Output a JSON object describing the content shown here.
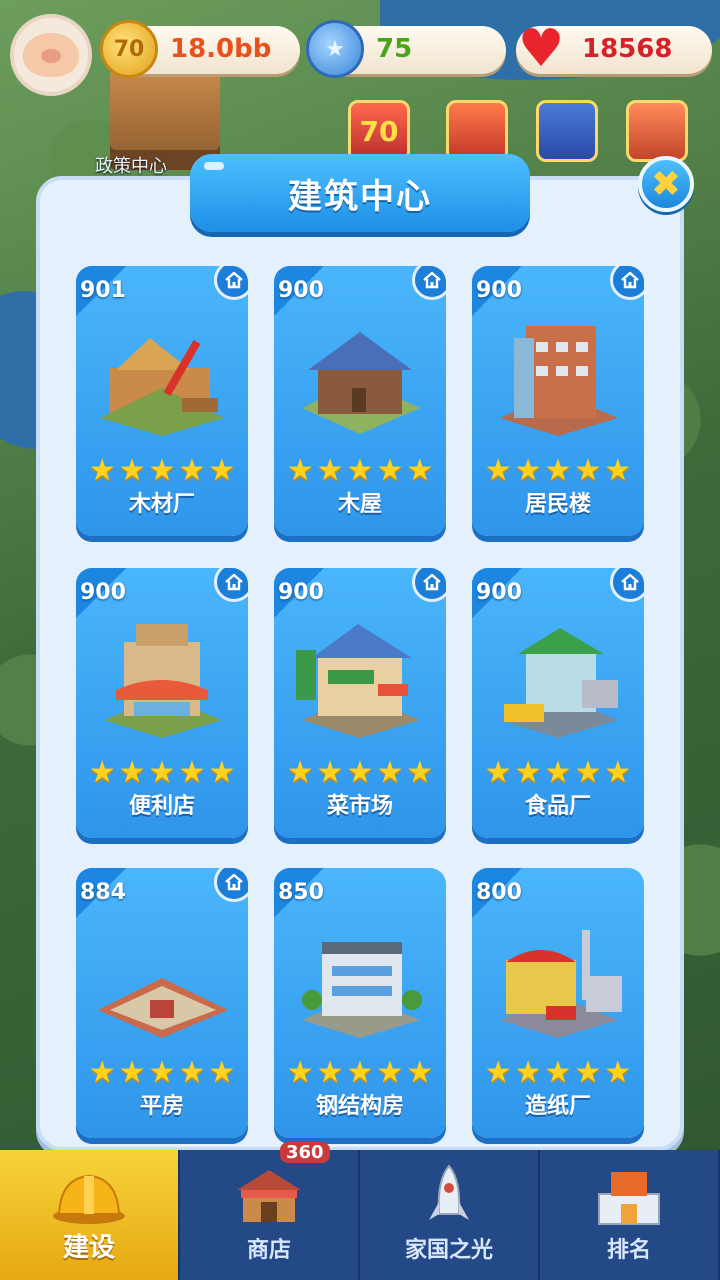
{
  "background": {
    "caption": "政策中心",
    "event_icon_text": "70"
  },
  "resources": {
    "coins": "18.0bb",
    "coin_symbol": "70",
    "gems": "75",
    "hearts": "18568"
  },
  "modal": {
    "title": "建筑中心",
    "close_symbol": "✖"
  },
  "buildings": [
    {
      "count": "901",
      "name": "木材厂",
      "stars": 5,
      "home_badge": true
    },
    {
      "count": "900",
      "name": "木屋",
      "stars": 5,
      "home_badge": true
    },
    {
      "count": "900",
      "name": "居民楼",
      "stars": 5,
      "home_badge": true
    },
    {
      "count": "900",
      "name": "便利店",
      "stars": 5,
      "home_badge": true
    },
    {
      "count": "900",
      "name": "菜市场",
      "stars": 5,
      "home_badge": true
    },
    {
      "count": "900",
      "name": "食品厂",
      "stars": 5,
      "home_badge": true
    },
    {
      "count": "884",
      "name": "平房",
      "stars": 5,
      "home_badge": true
    },
    {
      "count": "850",
      "name": "钢结构房",
      "stars": 5,
      "home_badge": false
    },
    {
      "count": "800",
      "name": "造纸厂",
      "stars": 5,
      "home_badge": false
    }
  ],
  "bottom_nav": {
    "tabs": [
      {
        "label": "建设",
        "active": true
      },
      {
        "label": "商店",
        "active": false,
        "badge": "360"
      },
      {
        "label": "家国之光",
        "active": false
      },
      {
        "label": "排名",
        "active": false
      }
    ]
  },
  "colors": {
    "card_blue": "#3aa4f4",
    "title_blue": "#2a9bf0",
    "star_gold": "#ffd21f",
    "coin_text": "#e8501c",
    "gem_text": "#4aa51a",
    "heart_text": "#d8202a"
  }
}
